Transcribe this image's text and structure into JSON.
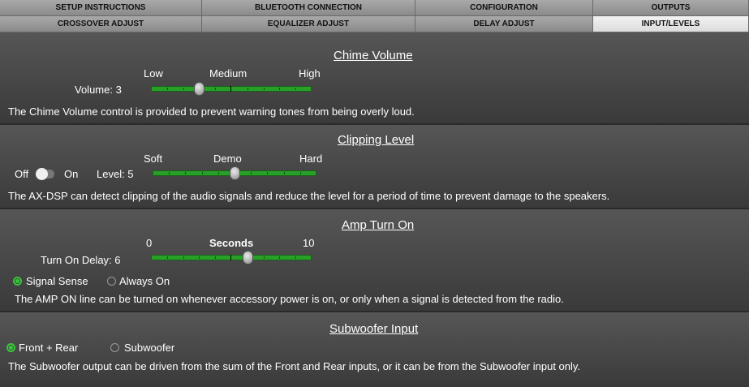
{
  "tabs": {
    "setup": "SETUP INSTRUCTIONS",
    "bluetooth": "BLUETOOTH CONNECTION",
    "configuration": "CONFIGURATION",
    "outputs": "OUTPUTS",
    "crossover": "CROSSOVER ADJUST",
    "equalizer": "EQUALIZER ADJUST",
    "delay": "DELAY ADJUST",
    "input_levels": "INPUT/LEVELS"
  },
  "chime": {
    "title": "Chime Volume",
    "scale_low": "Low",
    "scale_mid": "Medium",
    "scale_high": "High",
    "label": "Volume: 3",
    "value": 3,
    "description": "The Chime Volume control is provided to prevent warning tones from being overly loud."
  },
  "clipping": {
    "title": "Clipping Level",
    "toggle_off": "Off",
    "toggle_on": "On",
    "toggle_state": "off",
    "scale_low": "Soft",
    "scale_mid": "Demo",
    "scale_high": "Hard",
    "label": "Level: 5",
    "value": 5,
    "description": "The AX-DSP can detect clipping of the audio signals and reduce the level for a period of time to prevent damage to the speakers."
  },
  "amp": {
    "title": "Amp Turn On",
    "scale_low": "0",
    "scale_mid": "Seconds",
    "scale_high": "10",
    "label": "Turn On Delay: 6",
    "value": 6,
    "option_signal": "Signal Sense",
    "option_always": "Always On",
    "selected": "Signal Sense",
    "description": "The AMP ON line can be turned on whenever accessory power is on, or only when a signal is detected from the radio."
  },
  "sub": {
    "title": "Subwoofer Input",
    "option_front_rear": "Front + Rear",
    "option_subwoofer": "Subwoofer",
    "selected": "Front + Rear",
    "description": "The Subwoofer output can be driven from the sum of the Front and Rear inputs, or it can be from the Subwoofer input only."
  },
  "colors": {
    "accent_green": "#28a028",
    "active_tab": "#e8e8e8",
    "panel_bg": "#4a4a4a"
  }
}
